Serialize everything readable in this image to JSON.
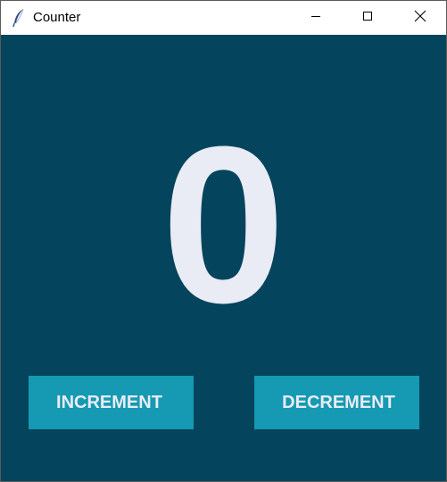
{
  "window": {
    "title": "Counter",
    "app_icon": "feather-icon",
    "controls": {
      "minimize_icon": "minimize-icon",
      "maximize_icon": "maximize-icon",
      "close_icon": "close-icon"
    }
  },
  "counter": {
    "value": "0"
  },
  "buttons": {
    "increment_label": "INCREMENT",
    "decrement_label": "DECREMENT"
  },
  "colors": {
    "background": "#04445c",
    "button": "#1699b3",
    "counter_text": "#e9ebf5",
    "button_text": "#e8ecf4"
  }
}
